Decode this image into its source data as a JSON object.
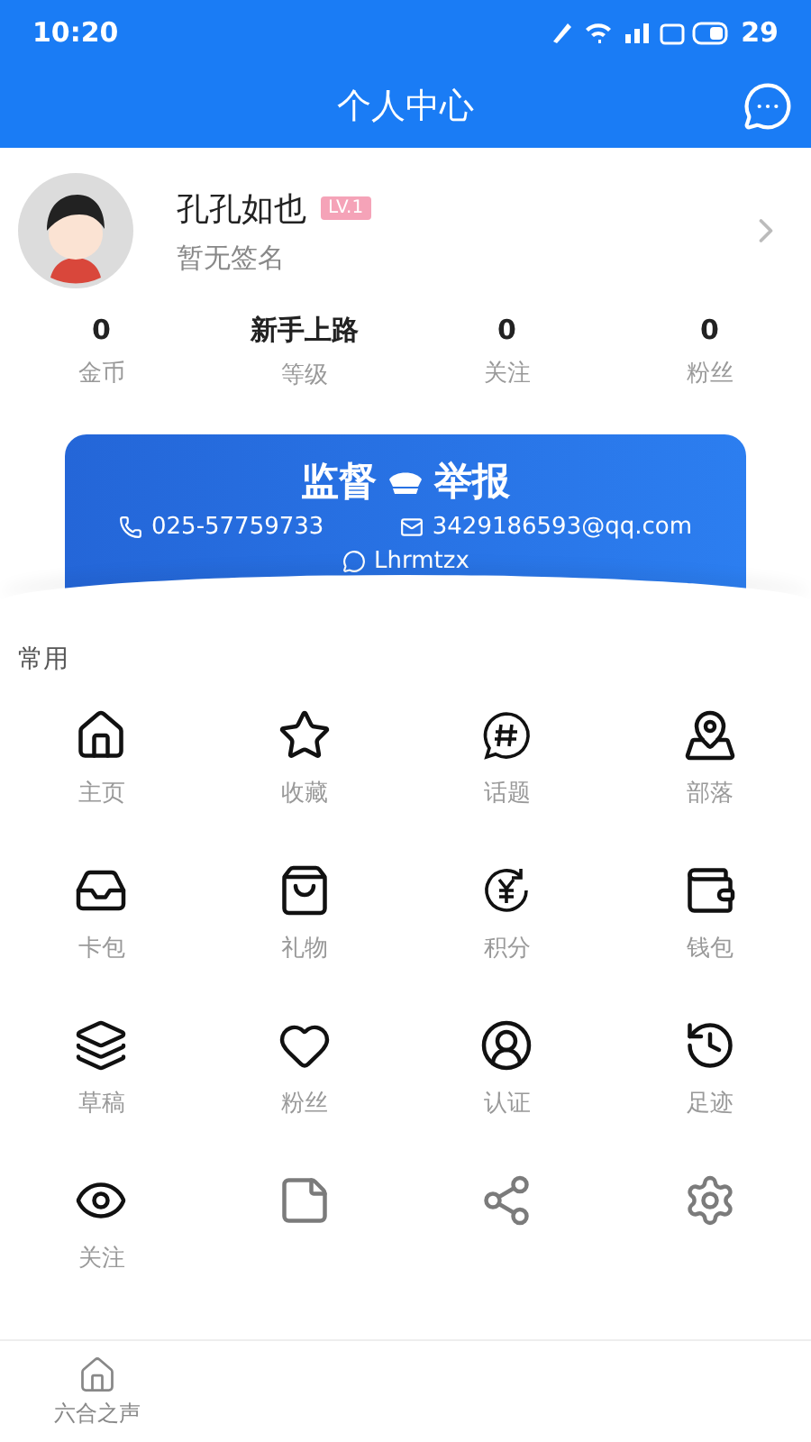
{
  "status_bar": {
    "time": "10:20",
    "battery": "29"
  },
  "header": {
    "title": "个人中心"
  },
  "profile": {
    "name": "孔孔如也",
    "level_badge": "LV.1",
    "signature": "暂无签名"
  },
  "stats": [
    {
      "value": "0",
      "label": "金币"
    },
    {
      "value": "新手上路",
      "label": "等级"
    },
    {
      "value": "0",
      "label": "关注"
    },
    {
      "value": "0",
      "label": "粉丝"
    }
  ],
  "report_banner": {
    "title_left": "监督",
    "title_right": "举报",
    "phone": "025-57759733",
    "email": "3429186593@qq.com",
    "wechat": "Lhrmtzx"
  },
  "section": {
    "title": "常用"
  },
  "grid": [
    {
      "label": "主页"
    },
    {
      "label": "收藏"
    },
    {
      "label": "话题"
    },
    {
      "label": "部落"
    },
    {
      "label": "卡包"
    },
    {
      "label": "礼物"
    },
    {
      "label": "积分"
    },
    {
      "label": "钱包"
    },
    {
      "label": "草稿"
    },
    {
      "label": "粉丝"
    },
    {
      "label": "认证"
    },
    {
      "label": "足迹"
    },
    {
      "label": "关注"
    },
    {
      "kind": "icon_only"
    },
    {
      "kind": "icon_only"
    },
    {
      "kind": "icon_only"
    }
  ],
  "bottom_nav": [
    {
      "label": "六合之声"
    }
  ]
}
